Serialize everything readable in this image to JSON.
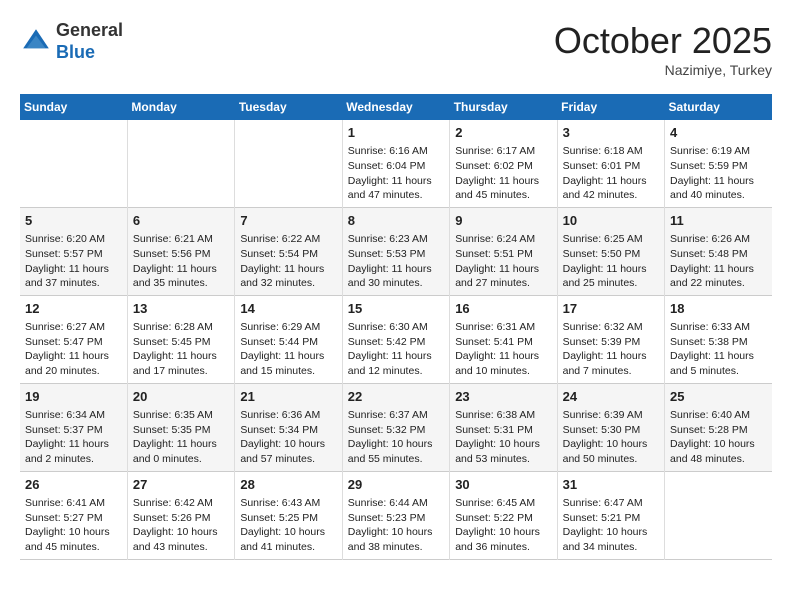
{
  "header": {
    "logo_line1": "General",
    "logo_line2": "Blue",
    "month": "October 2025",
    "location": "Nazimiye, Turkey"
  },
  "days_of_week": [
    "Sunday",
    "Monday",
    "Tuesday",
    "Wednesday",
    "Thursday",
    "Friday",
    "Saturday"
  ],
  "weeks": [
    [
      {
        "day": "",
        "content": ""
      },
      {
        "day": "",
        "content": ""
      },
      {
        "day": "",
        "content": ""
      },
      {
        "day": "1",
        "content": "Sunrise: 6:16 AM\nSunset: 6:04 PM\nDaylight: 11 hours\nand 47 minutes."
      },
      {
        "day": "2",
        "content": "Sunrise: 6:17 AM\nSunset: 6:02 PM\nDaylight: 11 hours\nand 45 minutes."
      },
      {
        "day": "3",
        "content": "Sunrise: 6:18 AM\nSunset: 6:01 PM\nDaylight: 11 hours\nand 42 minutes."
      },
      {
        "day": "4",
        "content": "Sunrise: 6:19 AM\nSunset: 5:59 PM\nDaylight: 11 hours\nand 40 minutes."
      }
    ],
    [
      {
        "day": "5",
        "content": "Sunrise: 6:20 AM\nSunset: 5:57 PM\nDaylight: 11 hours\nand 37 minutes."
      },
      {
        "day": "6",
        "content": "Sunrise: 6:21 AM\nSunset: 5:56 PM\nDaylight: 11 hours\nand 35 minutes."
      },
      {
        "day": "7",
        "content": "Sunrise: 6:22 AM\nSunset: 5:54 PM\nDaylight: 11 hours\nand 32 minutes."
      },
      {
        "day": "8",
        "content": "Sunrise: 6:23 AM\nSunset: 5:53 PM\nDaylight: 11 hours\nand 30 minutes."
      },
      {
        "day": "9",
        "content": "Sunrise: 6:24 AM\nSunset: 5:51 PM\nDaylight: 11 hours\nand 27 minutes."
      },
      {
        "day": "10",
        "content": "Sunrise: 6:25 AM\nSunset: 5:50 PM\nDaylight: 11 hours\nand 25 minutes."
      },
      {
        "day": "11",
        "content": "Sunrise: 6:26 AM\nSunset: 5:48 PM\nDaylight: 11 hours\nand 22 minutes."
      }
    ],
    [
      {
        "day": "12",
        "content": "Sunrise: 6:27 AM\nSunset: 5:47 PM\nDaylight: 11 hours\nand 20 minutes."
      },
      {
        "day": "13",
        "content": "Sunrise: 6:28 AM\nSunset: 5:45 PM\nDaylight: 11 hours\nand 17 minutes."
      },
      {
        "day": "14",
        "content": "Sunrise: 6:29 AM\nSunset: 5:44 PM\nDaylight: 11 hours\nand 15 minutes."
      },
      {
        "day": "15",
        "content": "Sunrise: 6:30 AM\nSunset: 5:42 PM\nDaylight: 11 hours\nand 12 minutes."
      },
      {
        "day": "16",
        "content": "Sunrise: 6:31 AM\nSunset: 5:41 PM\nDaylight: 11 hours\nand 10 minutes."
      },
      {
        "day": "17",
        "content": "Sunrise: 6:32 AM\nSunset: 5:39 PM\nDaylight: 11 hours\nand 7 minutes."
      },
      {
        "day": "18",
        "content": "Sunrise: 6:33 AM\nSunset: 5:38 PM\nDaylight: 11 hours\nand 5 minutes."
      }
    ],
    [
      {
        "day": "19",
        "content": "Sunrise: 6:34 AM\nSunset: 5:37 PM\nDaylight: 11 hours\nand 2 minutes."
      },
      {
        "day": "20",
        "content": "Sunrise: 6:35 AM\nSunset: 5:35 PM\nDaylight: 11 hours\nand 0 minutes."
      },
      {
        "day": "21",
        "content": "Sunrise: 6:36 AM\nSunset: 5:34 PM\nDaylight: 10 hours\nand 57 minutes."
      },
      {
        "day": "22",
        "content": "Sunrise: 6:37 AM\nSunset: 5:32 PM\nDaylight: 10 hours\nand 55 minutes."
      },
      {
        "day": "23",
        "content": "Sunrise: 6:38 AM\nSunset: 5:31 PM\nDaylight: 10 hours\nand 53 minutes."
      },
      {
        "day": "24",
        "content": "Sunrise: 6:39 AM\nSunset: 5:30 PM\nDaylight: 10 hours\nand 50 minutes."
      },
      {
        "day": "25",
        "content": "Sunrise: 6:40 AM\nSunset: 5:28 PM\nDaylight: 10 hours\nand 48 minutes."
      }
    ],
    [
      {
        "day": "26",
        "content": "Sunrise: 6:41 AM\nSunset: 5:27 PM\nDaylight: 10 hours\nand 45 minutes."
      },
      {
        "day": "27",
        "content": "Sunrise: 6:42 AM\nSunset: 5:26 PM\nDaylight: 10 hours\nand 43 minutes."
      },
      {
        "day": "28",
        "content": "Sunrise: 6:43 AM\nSunset: 5:25 PM\nDaylight: 10 hours\nand 41 minutes."
      },
      {
        "day": "29",
        "content": "Sunrise: 6:44 AM\nSunset: 5:23 PM\nDaylight: 10 hours\nand 38 minutes."
      },
      {
        "day": "30",
        "content": "Sunrise: 6:45 AM\nSunset: 5:22 PM\nDaylight: 10 hours\nand 36 minutes."
      },
      {
        "day": "31",
        "content": "Sunrise: 6:47 AM\nSunset: 5:21 PM\nDaylight: 10 hours\nand 34 minutes."
      },
      {
        "day": "",
        "content": ""
      }
    ]
  ]
}
